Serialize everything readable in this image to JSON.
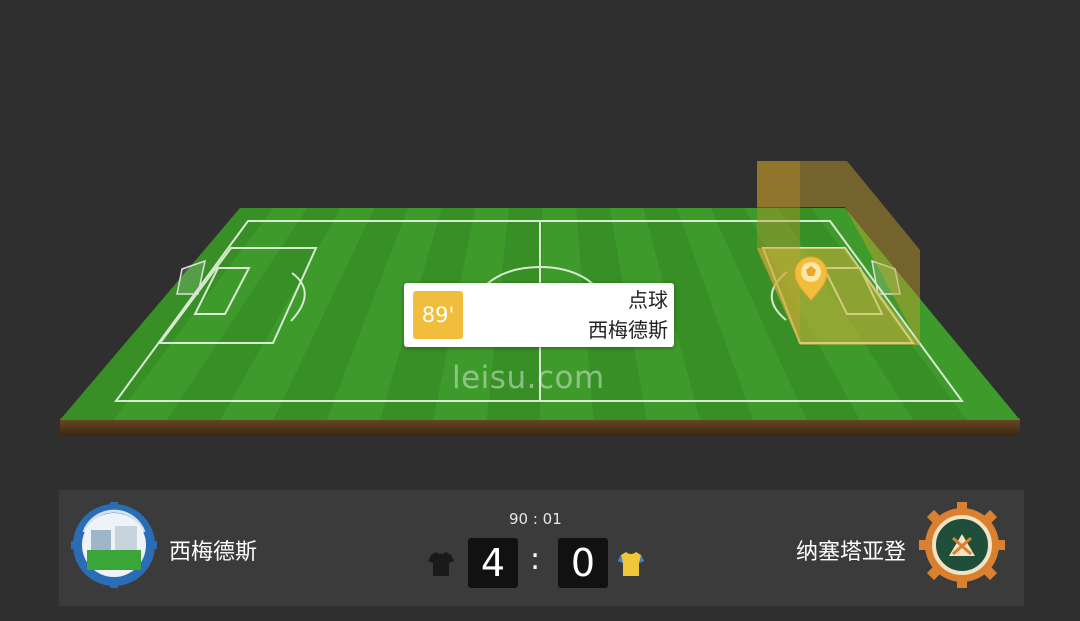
{
  "event": {
    "minute": "89'",
    "type": "点球",
    "team": "西梅德斯"
  },
  "watermark": "leisu.com",
  "match": {
    "clock": "90 : 01",
    "separator": ":",
    "home": {
      "name": "西梅德斯",
      "score": "4",
      "kit_color": "#1a1a1a",
      "logo": "home-team-crest"
    },
    "away": {
      "name": "纳塞塔亚登",
      "score": "0",
      "kit_color": "#f0c63a",
      "kit_accent": "#3d7fd6",
      "logo": "away-team-crest"
    }
  },
  "colors": {
    "background": "#2f2f2f",
    "pitch_light": "#3f9a2c",
    "pitch_dark": "#358a24",
    "highlight_zone": "#c9a42c",
    "minute_badge": "#f1bd3c",
    "panel": "#3b3b3b",
    "score_box": "#111111"
  }
}
